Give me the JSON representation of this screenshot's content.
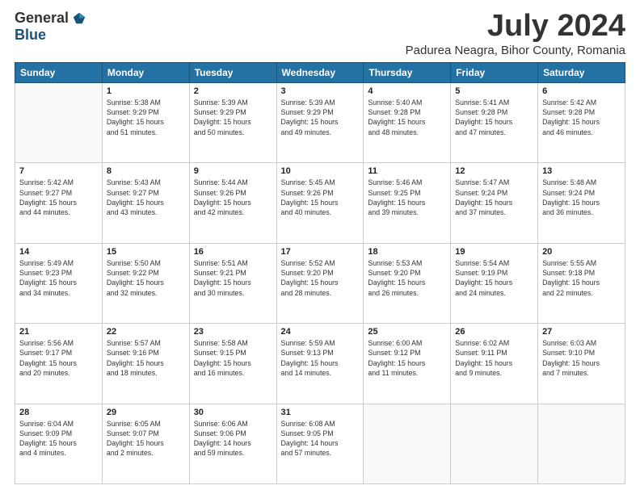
{
  "logo": {
    "general": "General",
    "blue": "Blue"
  },
  "title": "July 2024",
  "location": "Padurea Neagra, Bihor County, Romania",
  "headers": [
    "Sunday",
    "Monday",
    "Tuesday",
    "Wednesday",
    "Thursday",
    "Friday",
    "Saturday"
  ],
  "weeks": [
    [
      {
        "day": "",
        "info": ""
      },
      {
        "day": "1",
        "info": "Sunrise: 5:38 AM\nSunset: 9:29 PM\nDaylight: 15 hours\nand 51 minutes."
      },
      {
        "day": "2",
        "info": "Sunrise: 5:39 AM\nSunset: 9:29 PM\nDaylight: 15 hours\nand 50 minutes."
      },
      {
        "day": "3",
        "info": "Sunrise: 5:39 AM\nSunset: 9:29 PM\nDaylight: 15 hours\nand 49 minutes."
      },
      {
        "day": "4",
        "info": "Sunrise: 5:40 AM\nSunset: 9:28 PM\nDaylight: 15 hours\nand 48 minutes."
      },
      {
        "day": "5",
        "info": "Sunrise: 5:41 AM\nSunset: 9:28 PM\nDaylight: 15 hours\nand 47 minutes."
      },
      {
        "day": "6",
        "info": "Sunrise: 5:42 AM\nSunset: 9:28 PM\nDaylight: 15 hours\nand 46 minutes."
      }
    ],
    [
      {
        "day": "7",
        "info": "Sunrise: 5:42 AM\nSunset: 9:27 PM\nDaylight: 15 hours\nand 44 minutes."
      },
      {
        "day": "8",
        "info": "Sunrise: 5:43 AM\nSunset: 9:27 PM\nDaylight: 15 hours\nand 43 minutes."
      },
      {
        "day": "9",
        "info": "Sunrise: 5:44 AM\nSunset: 9:26 PM\nDaylight: 15 hours\nand 42 minutes."
      },
      {
        "day": "10",
        "info": "Sunrise: 5:45 AM\nSunset: 9:26 PM\nDaylight: 15 hours\nand 40 minutes."
      },
      {
        "day": "11",
        "info": "Sunrise: 5:46 AM\nSunset: 9:25 PM\nDaylight: 15 hours\nand 39 minutes."
      },
      {
        "day": "12",
        "info": "Sunrise: 5:47 AM\nSunset: 9:24 PM\nDaylight: 15 hours\nand 37 minutes."
      },
      {
        "day": "13",
        "info": "Sunrise: 5:48 AM\nSunset: 9:24 PM\nDaylight: 15 hours\nand 36 minutes."
      }
    ],
    [
      {
        "day": "14",
        "info": "Sunrise: 5:49 AM\nSunset: 9:23 PM\nDaylight: 15 hours\nand 34 minutes."
      },
      {
        "day": "15",
        "info": "Sunrise: 5:50 AM\nSunset: 9:22 PM\nDaylight: 15 hours\nand 32 minutes."
      },
      {
        "day": "16",
        "info": "Sunrise: 5:51 AM\nSunset: 9:21 PM\nDaylight: 15 hours\nand 30 minutes."
      },
      {
        "day": "17",
        "info": "Sunrise: 5:52 AM\nSunset: 9:20 PM\nDaylight: 15 hours\nand 28 minutes."
      },
      {
        "day": "18",
        "info": "Sunrise: 5:53 AM\nSunset: 9:20 PM\nDaylight: 15 hours\nand 26 minutes."
      },
      {
        "day": "19",
        "info": "Sunrise: 5:54 AM\nSunset: 9:19 PM\nDaylight: 15 hours\nand 24 minutes."
      },
      {
        "day": "20",
        "info": "Sunrise: 5:55 AM\nSunset: 9:18 PM\nDaylight: 15 hours\nand 22 minutes."
      }
    ],
    [
      {
        "day": "21",
        "info": "Sunrise: 5:56 AM\nSunset: 9:17 PM\nDaylight: 15 hours\nand 20 minutes."
      },
      {
        "day": "22",
        "info": "Sunrise: 5:57 AM\nSunset: 9:16 PM\nDaylight: 15 hours\nand 18 minutes."
      },
      {
        "day": "23",
        "info": "Sunrise: 5:58 AM\nSunset: 9:15 PM\nDaylight: 15 hours\nand 16 minutes."
      },
      {
        "day": "24",
        "info": "Sunrise: 5:59 AM\nSunset: 9:13 PM\nDaylight: 15 hours\nand 14 minutes."
      },
      {
        "day": "25",
        "info": "Sunrise: 6:00 AM\nSunset: 9:12 PM\nDaylight: 15 hours\nand 11 minutes."
      },
      {
        "day": "26",
        "info": "Sunrise: 6:02 AM\nSunset: 9:11 PM\nDaylight: 15 hours\nand 9 minutes."
      },
      {
        "day": "27",
        "info": "Sunrise: 6:03 AM\nSunset: 9:10 PM\nDaylight: 15 hours\nand 7 minutes."
      }
    ],
    [
      {
        "day": "28",
        "info": "Sunrise: 6:04 AM\nSunset: 9:09 PM\nDaylight: 15 hours\nand 4 minutes."
      },
      {
        "day": "29",
        "info": "Sunrise: 6:05 AM\nSunset: 9:07 PM\nDaylight: 15 hours\nand 2 minutes."
      },
      {
        "day": "30",
        "info": "Sunrise: 6:06 AM\nSunset: 9:06 PM\nDaylight: 14 hours\nand 59 minutes."
      },
      {
        "day": "31",
        "info": "Sunrise: 6:08 AM\nSunset: 9:05 PM\nDaylight: 14 hours\nand 57 minutes."
      },
      {
        "day": "",
        "info": ""
      },
      {
        "day": "",
        "info": ""
      },
      {
        "day": "",
        "info": ""
      }
    ]
  ]
}
